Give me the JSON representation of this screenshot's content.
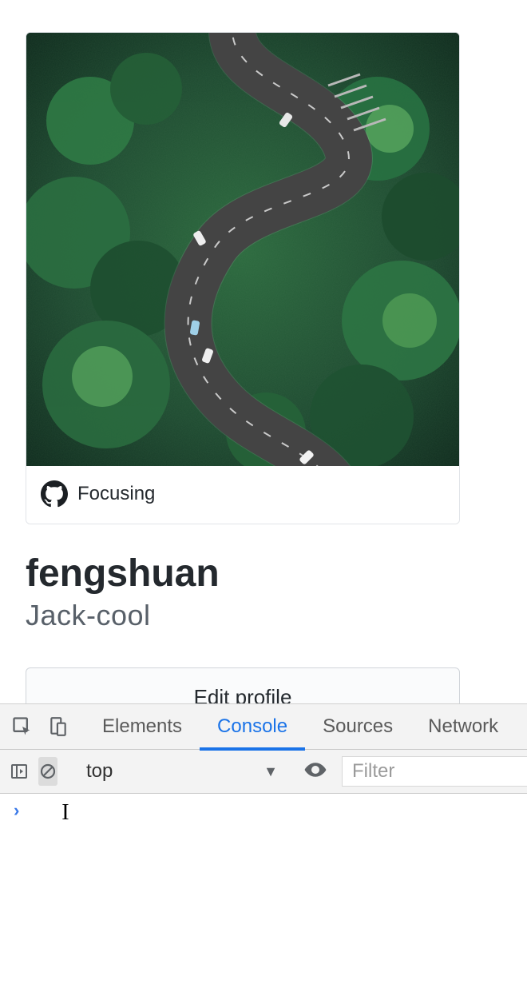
{
  "profile": {
    "status_text": "Focusing",
    "display_name": "fengshuan",
    "username": "Jack-cool",
    "edit_button_label": "Edit profile"
  },
  "devtools": {
    "tabs": [
      "Elements",
      "Console",
      "Sources",
      "Network"
    ],
    "active_tab": "Console",
    "context_label": "top",
    "filter_placeholder": "Filter",
    "prompt": "›",
    "colors": {
      "tab_active": "#1a73e8",
      "toolbar_bg": "#f3f3f3"
    }
  }
}
